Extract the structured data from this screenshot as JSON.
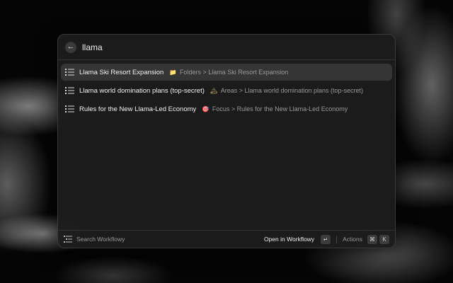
{
  "search": {
    "query": "llama",
    "back_glyph": "←"
  },
  "results": [
    {
      "title": "Llama Ski Resort Expansion",
      "emoji": "📁",
      "path": "Folders > Llama Ski Resort Expansion",
      "selected": true
    },
    {
      "title": "Llama world domination plans (top-secret)",
      "emoji": "🏔",
      "path": "Areas > Llama world domination plans (top-secret)",
      "selected": false
    },
    {
      "title": "Rules for the New Llama-Led Economy",
      "emoji": "🎯",
      "path": "Focus > Rules for the New Llama-Led Economy",
      "selected": false
    }
  ],
  "footer": {
    "search_label": "Search Workflowy",
    "open_label": "Open in Workflowy",
    "enter_key": "↵",
    "actions_label": "Actions",
    "cmd_key": "⌘",
    "k_key": "K"
  }
}
